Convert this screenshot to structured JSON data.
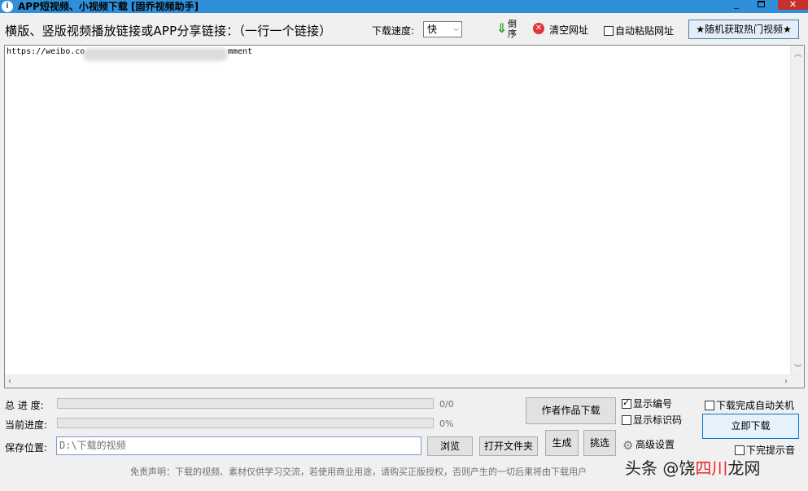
{
  "window": {
    "title": "APP短视频、小视频下载 [固乔视频助手]",
    "app_icon": "i",
    "minimize": "_",
    "close": "✕"
  },
  "toolbar": {
    "prompt": "横版、竖版视频播放链接或APP分享链接：（一行一个链接）",
    "speed_label": "下载速度:",
    "speed_value": "快",
    "reverse_label": "倒序",
    "clear_label": "清空网址",
    "auto_paste_label": "自动粘贴网址",
    "auto_paste_checked": false,
    "hot_button": "★随机获取热门视频★"
  },
  "editor": {
    "line_start": "https://weibo.co",
    "line_end": "mment"
  },
  "progress": {
    "total_label": "总 进 度:",
    "total_value": "0/0",
    "total_fraction": 0,
    "current_label": "当前进度:",
    "current_value": "0%",
    "current_fraction": 0
  },
  "save": {
    "label": "保存位置:",
    "path": "D:\\下载的视频",
    "browse_button": "浏览",
    "open_folder_button": "打开文件夹"
  },
  "actions": {
    "author_download": "作者作品下载",
    "generate": "生成",
    "pick": "挑选",
    "show_number": "显示编号",
    "show_number_checked": true,
    "show_id_code": "显示标识码",
    "show_id_code_checked": false,
    "advanced_settings": "高级设置",
    "auto_shutdown": "下载完成自动关机",
    "auto_shutdown_checked": false,
    "download_now": "立即下载",
    "finish_sound": "下完提示音",
    "finish_sound_checked": false
  },
  "footer": {
    "disclaimer": "免责声明：下载的视频、素材仅供学习交流，若使用商业用途，请购买正版授权，否则产生的一切后果将由下载用户",
    "watermark_left": "头条 @饶",
    "watermark_highlight": "四川",
    "watermark_right": "龙网"
  },
  "colors": {
    "titlebar": "#2f8fd8",
    "progress_fill": "#06b025",
    "close": "#c7302c",
    "clear_icon": "#e0343a",
    "reverse_arrow": "#2a9d2a"
  }
}
